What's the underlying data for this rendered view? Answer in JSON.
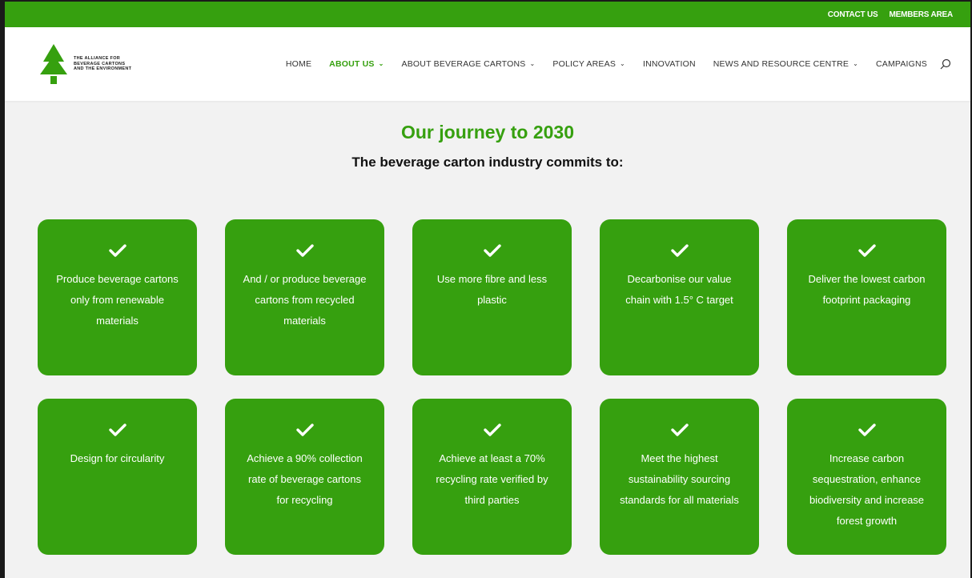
{
  "topbar": {
    "contact": "CONTACT US",
    "members": "MEMBERS AREA"
  },
  "logo": {
    "line1": "THE ALLIANCE FOR",
    "line2": "BEVERAGE CARTONS",
    "line3": "AND THE ENVIRONMENT"
  },
  "nav": {
    "items": [
      {
        "label": "HOME"
      },
      {
        "label": "ABOUT US"
      },
      {
        "label": "ABOUT BEVERAGE CARTONS"
      },
      {
        "label": "POLICY AREAS"
      },
      {
        "label": "INNOVATION"
      },
      {
        "label": "NEWS AND RESOURCE CENTRE"
      },
      {
        "label": "CAMPAIGNS"
      }
    ]
  },
  "main": {
    "title": "Our journey to 2030",
    "subtitle": "The beverage carton industry commits to:"
  },
  "cards": [
    {
      "text": "Produce beverage cartons only from renewable materials"
    },
    {
      "text": "And / or produce beverage cartons from recycled materials"
    },
    {
      "text": "Use more fibre and less plastic"
    },
    {
      "text": "Decarbonise our value chain with 1.5° C target"
    },
    {
      "text": "Deliver the lowest carbon footprint packaging"
    },
    {
      "text": "Design for circularity"
    },
    {
      "text": "Achieve a 90% collection rate of beverage cartons for recycling"
    },
    {
      "text": "Achieve at least a 70% recycling rate verified by third parties"
    },
    {
      "text": "Meet the highest sustainability sourcing standards for all materials"
    },
    {
      "text": "Increase carbon sequestration, enhance biodiversity and increase forest growth"
    }
  ],
  "colors": {
    "brand_green": "#36a00f",
    "background": "#f2f2f2"
  }
}
